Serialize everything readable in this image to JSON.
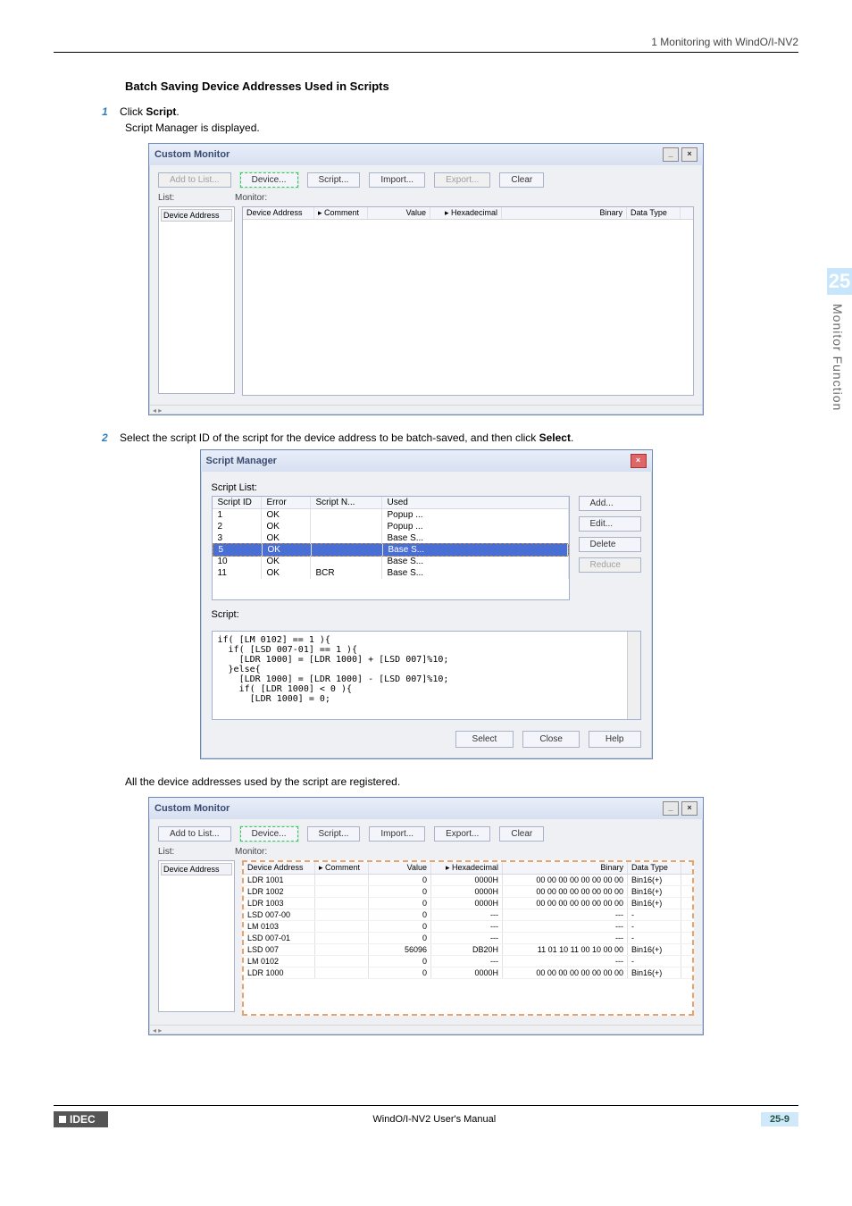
{
  "header": {
    "breadcrumb": "1 Monitoring with WindO/I-NV2"
  },
  "section": {
    "title": "Batch Saving Device Addresses Used in Scripts"
  },
  "steps": {
    "s1_num": "1",
    "s1_pre": "Click ",
    "s1_bold": "Script",
    "s1_post": ".",
    "s1_sub": "Script Manager is displayed.",
    "s2_num": "2",
    "s2_pre": "Select the script ID of the script for the device address to be batch-saved, and then click ",
    "s2_bold": "Select",
    "s2_post": ".",
    "note": "All the device addresses used by the script are registered."
  },
  "custom_monitor": {
    "title": "Custom Monitor",
    "btn_add": "Add to List...",
    "btn_device": "Device...",
    "btn_script": "Script...",
    "btn_import": "Import...",
    "btn_export": "Export...",
    "btn_clear": "Clear",
    "label_list": "List:",
    "label_monitor": "Monitor:",
    "list_header": "Device Address",
    "mon_headers": {
      "addr": "Device Address",
      "comment": "▸ Comment",
      "value": "Value",
      "hex": "▸ Hexadecimal",
      "bin": "Binary",
      "dtype": "Data Type"
    }
  },
  "script_manager": {
    "title": "Script Manager",
    "label_list": "Script List:",
    "headers": {
      "id": "Script ID",
      "err": "Error",
      "name": "Script N...",
      "used": "Used"
    },
    "rows": [
      {
        "id": "1",
        "err": "OK",
        "name": "",
        "used": "Popup ..."
      },
      {
        "id": "2",
        "err": "OK",
        "name": "",
        "used": "Popup ..."
      },
      {
        "id": "3",
        "err": "OK",
        "name": "",
        "used": "Base S..."
      },
      {
        "id": "5",
        "err": "OK",
        "name": "",
        "used": "Base S...",
        "selected": true
      },
      {
        "id": "10",
        "err": "OK",
        "name": "",
        "used": "Base S..."
      },
      {
        "id": "11",
        "err": "OK",
        "name": "BCR",
        "used": "Base S..."
      }
    ],
    "btn_add": "Add...",
    "btn_edit": "Edit...",
    "btn_delete": "Delete",
    "btn_reduce": "Reduce",
    "label_script": "Script:",
    "script_body": "if( [LM 0102] == 1 ){\n  if( [LSD 007-01] == 1 ){\n    [LDR 1000] = [LDR 1000] + [LSD 007]%10;\n  }else{\n    [LDR 1000] = [LDR 1000] - [LSD 007]%10;\n    if( [LDR 1000] < 0 ){\n      [LDR 1000] = 0;",
    "btn_select": "Select",
    "btn_close": "Close",
    "btn_help": "Help"
  },
  "monitor_rows": [
    {
      "addr": "LDR 1001",
      "com": "",
      "val": "0",
      "hex": "0000H",
      "bin": "00 00 00 00 00 00 00 00",
      "dt": "Bin16(+)"
    },
    {
      "addr": "LDR 1002",
      "com": "",
      "val": "0",
      "hex": "0000H",
      "bin": "00 00 00 00 00 00 00 00",
      "dt": "Bin16(+)"
    },
    {
      "addr": "LDR 1003",
      "com": "",
      "val": "0",
      "hex": "0000H",
      "bin": "00 00 00 00 00 00 00 00",
      "dt": "Bin16(+)"
    },
    {
      "addr": "LSD 007-00",
      "com": "",
      "val": "0",
      "hex": "---",
      "bin": "---",
      "dt": "-"
    },
    {
      "addr": "LM 0103",
      "com": "",
      "val": "0",
      "hex": "---",
      "bin": "---",
      "dt": "-"
    },
    {
      "addr": "LSD 007-01",
      "com": "",
      "val": "0",
      "hex": "---",
      "bin": "---",
      "dt": "-"
    },
    {
      "addr": "LSD 007",
      "com": "",
      "val": "56096",
      "hex": "DB20H",
      "bin": "11 01 10 11 00 10 00 00",
      "dt": "Bin16(+)"
    },
    {
      "addr": "LM 0102",
      "com": "",
      "val": "0",
      "hex": "---",
      "bin": "---",
      "dt": "-"
    },
    {
      "addr": "LDR 1000",
      "com": "",
      "val": "0",
      "hex": "0000H",
      "bin": "00 00 00 00 00 00 00 00",
      "dt": "Bin16(+)"
    }
  ],
  "side": {
    "num": "25",
    "label": "Monitor Function"
  },
  "footer": {
    "brand": "IDEC",
    "manual": "WindO/I-NV2 User's Manual",
    "page": "25-9"
  }
}
